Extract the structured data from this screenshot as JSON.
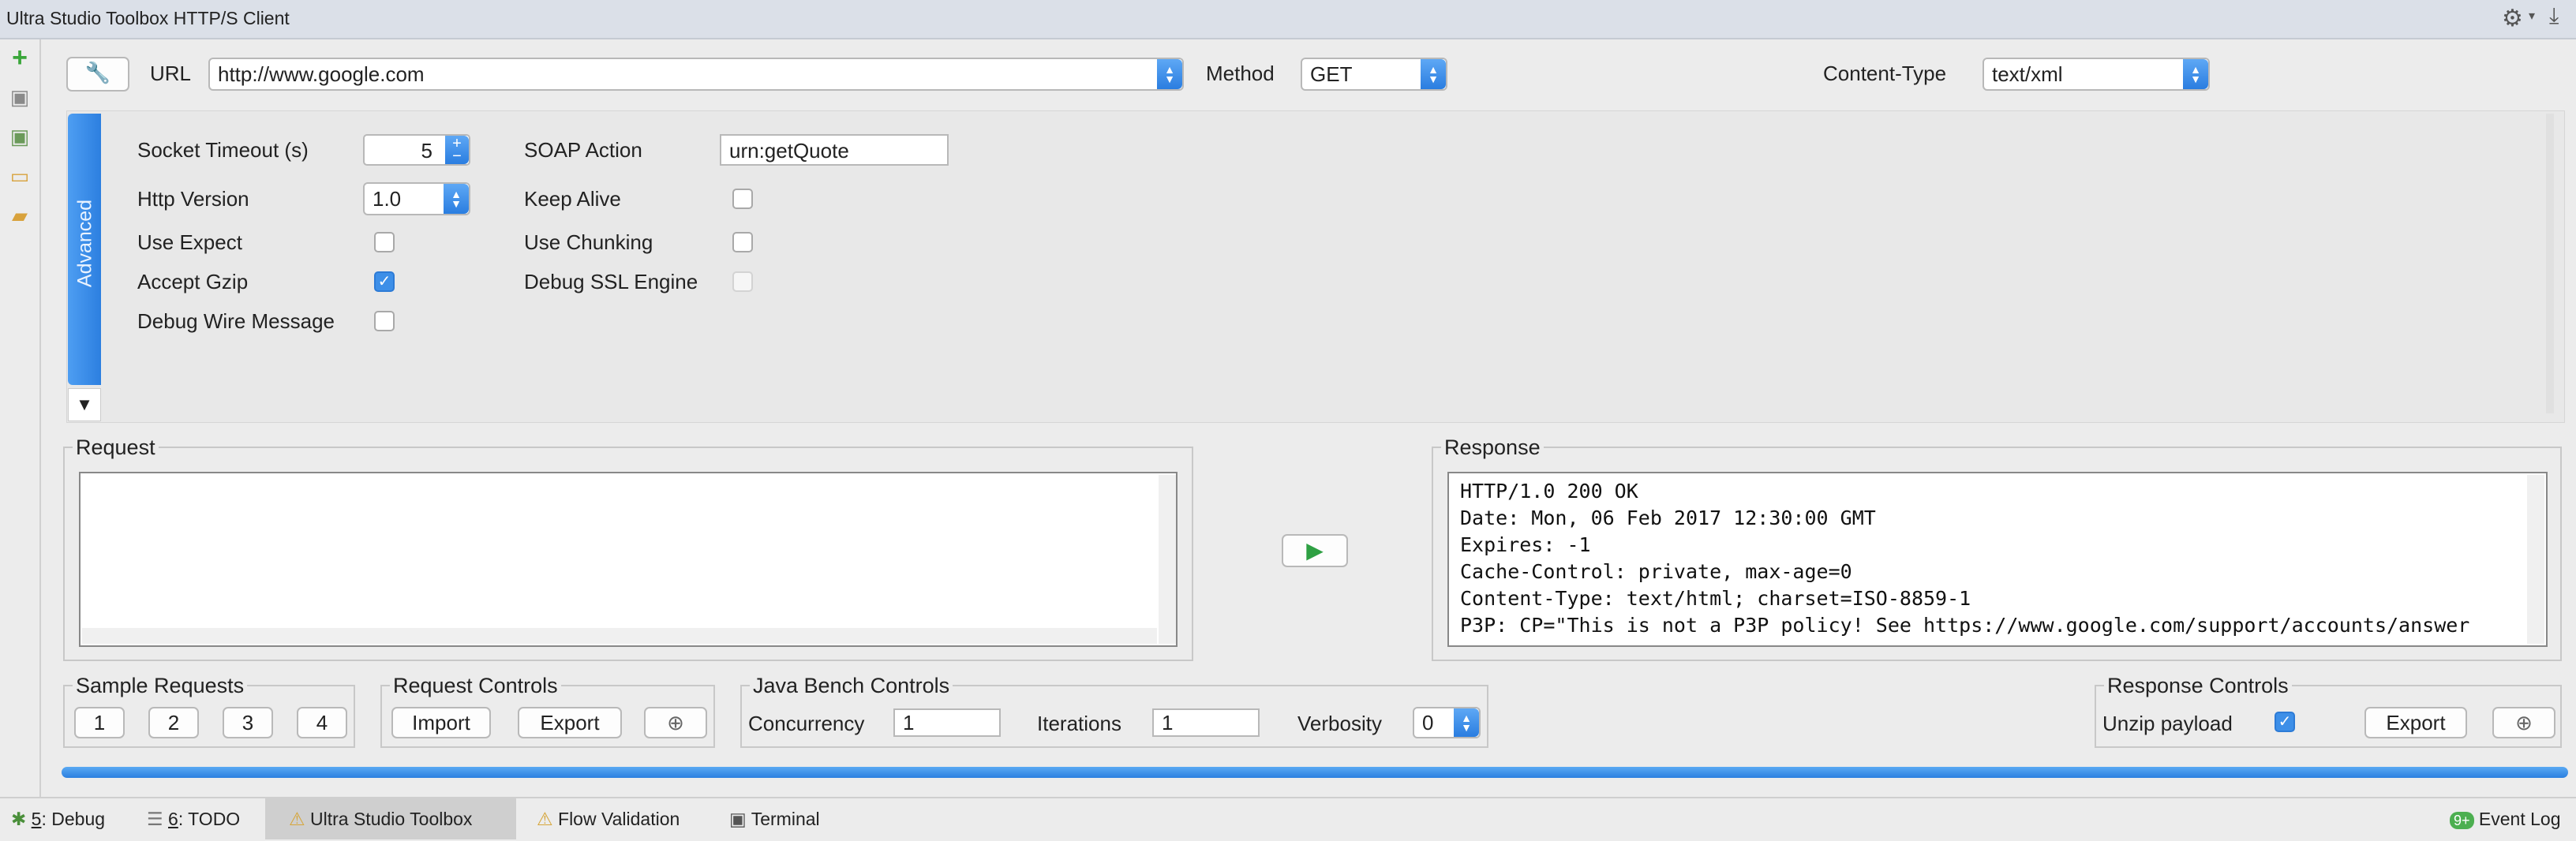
{
  "title": "Ultra Studio Toolbox HTTP/S Client",
  "icons": {
    "settings": "gear-icon",
    "download": "download-icon",
    "tool": "wrench-icon",
    "run": "play-icon",
    "zoom": "zoom-icon"
  },
  "toolbar": {
    "url_label": "URL",
    "url_value": "http://www.google.com",
    "method_label": "Method",
    "method_value": "GET",
    "content_type_label": "Content-Type",
    "content_type_value": "text/xml"
  },
  "advanced": {
    "tab_label": "Advanced",
    "socket_timeout_label": "Socket Timeout (s)",
    "socket_timeout_value": "5",
    "soap_action_label": "SOAP Action",
    "soap_action_value": "urn:getQuote",
    "http_version_label": "Http Version",
    "http_version_value": "1.0",
    "keep_alive_label": "Keep Alive",
    "use_expect_label": "Use Expect",
    "use_chunking_label": "Use Chunking",
    "accept_gzip_label": "Accept Gzip",
    "debug_ssl_label": "Debug SSL Engine",
    "debug_wire_label": "Debug Wire Message"
  },
  "request": {
    "title": "Request",
    "body": ""
  },
  "response": {
    "title": "Response",
    "lines": [
      "HTTP/1.0 200 OK",
      "Date: Mon, 06 Feb 2017 12:30:00 GMT",
      "Expires: -1",
      "Cache-Control: private, max-age=0",
      "Content-Type: text/html; charset=ISO-8859-1",
      "P3P: CP=\"This is not a P3P policy! See https://www.google.com/support/accounts/answer"
    ]
  },
  "sample_requests": {
    "title": "Sample Requests",
    "buttons": [
      "1",
      "2",
      "3",
      "4"
    ]
  },
  "request_controls": {
    "title": "Request Controls",
    "import": "Import",
    "export": "Export"
  },
  "bench": {
    "title": "Java Bench Controls",
    "concurrency_label": "Concurrency",
    "concurrency_value": "1",
    "iterations_label": "Iterations",
    "iterations_value": "1",
    "verbosity_label": "Verbosity",
    "verbosity_value": "0"
  },
  "response_controls": {
    "title": "Response Controls",
    "unzip_label": "Unzip payload",
    "export": "Export"
  },
  "statusbar": {
    "debug_num": "5",
    "debug": ": Debug",
    "todo_num": "6",
    "todo": ": TODO",
    "toolbox": "Ultra Studio Toolbox",
    "flow": "Flow Validation",
    "terminal": "Terminal",
    "event_badge": "9+",
    "event_log": "Event Log"
  }
}
